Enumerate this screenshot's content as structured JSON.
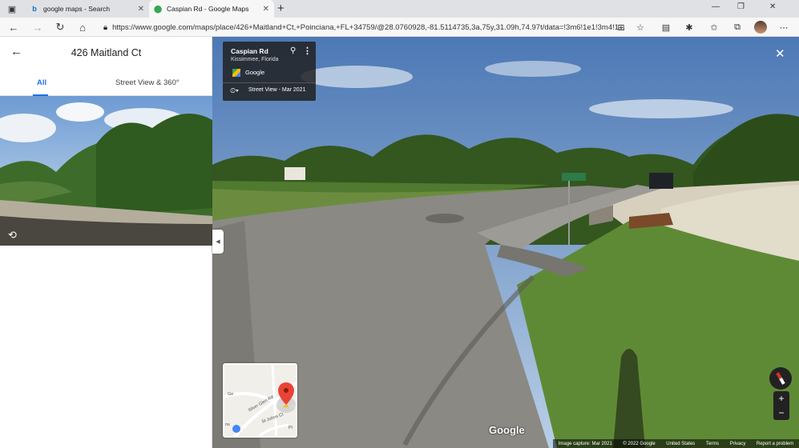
{
  "browser": {
    "tabs": [
      {
        "title": "google maps - Search",
        "favicon": "bing-icon",
        "active": false
      },
      {
        "title": "Caspian Rd - Google Maps",
        "favicon": "maps-pin-icon",
        "active": true
      }
    ],
    "url": "https://www.google.com/maps/place/426+Maitland+Ct,+Poinciana,+FL+34759/@28.0760928,-81.5114735,3a,75y,31.09h,74.97t/data=!3m6!1e1!3m4!1..."
  },
  "panel": {
    "title": "426 Maitland Ct",
    "tabs": [
      "All",
      "Street View & 360°"
    ]
  },
  "info_card": {
    "title": "Caspian Rd",
    "subtitle": "Kissimmee, Florida",
    "provider": "Google",
    "capture": "Street View - Mar 2021"
  },
  "minimap": {
    "labels": [
      "Silver Glen Rd",
      "St Johns Ct",
      "Pl",
      "ns",
      "Ge"
    ]
  },
  "zoom": {
    "in": "+",
    "out": "−"
  },
  "google_logo": "Google",
  "footer": [
    "Image capture: Mar 2021",
    "© 2022 Google",
    "United States",
    "Terms",
    "Privacy",
    "Report a problem"
  ],
  "colors": {
    "accent": "#1a73e8",
    "pin": "#ea4335"
  }
}
